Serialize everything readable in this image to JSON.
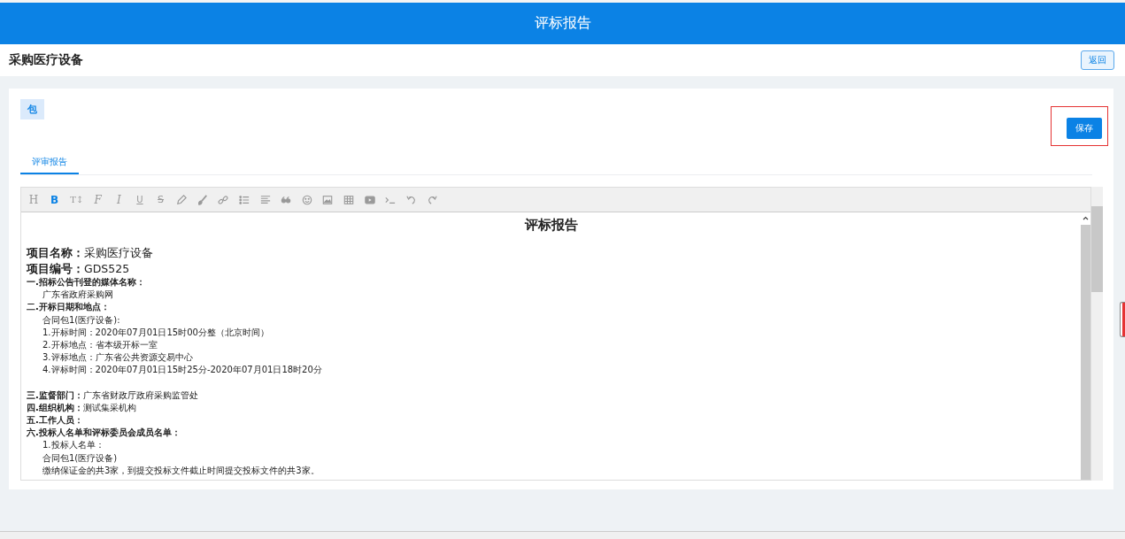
{
  "header": {
    "title": "评标报告"
  },
  "page": {
    "title": "采购医疗设备",
    "back_button": "返回"
  },
  "package_tag": "包",
  "save_button": {
    "label": "保存",
    "highlighted": true
  },
  "tabs": [
    {
      "label": "评审报告",
      "selected": true
    }
  ],
  "toolbar": [
    {
      "kind": "heading",
      "glyph": "H",
      "active": false
    },
    {
      "kind": "bold",
      "glyph": "B",
      "active": true
    },
    {
      "kind": "size",
      "glyph": "T↕",
      "active": false
    },
    {
      "kind": "font",
      "glyph": "F",
      "active": false
    },
    {
      "kind": "italic",
      "glyph": "I",
      "active": false
    },
    {
      "kind": "underline",
      "glyph": "U",
      "active": false
    },
    {
      "kind": "strike",
      "glyph": "S",
      "active": false
    },
    {
      "kind": "pencil",
      "active": false
    },
    {
      "kind": "brush",
      "active": false
    },
    {
      "kind": "link",
      "active": false
    },
    {
      "kind": "list",
      "active": false
    },
    {
      "kind": "align",
      "active": false
    },
    {
      "kind": "quote",
      "active": false
    },
    {
      "kind": "smile",
      "active": false
    },
    {
      "kind": "image",
      "active": false
    },
    {
      "kind": "table",
      "active": false
    },
    {
      "kind": "video",
      "active": false
    },
    {
      "kind": "terminal",
      "active": false
    },
    {
      "kind": "undo",
      "active": false
    },
    {
      "kind": "redo",
      "active": false
    }
  ],
  "document": {
    "title": "评标报告",
    "lines": [
      {
        "kind": "field",
        "label": "项目名称：",
        "value": "采购医疗设备"
      },
      {
        "kind": "field",
        "label": "项目编号：",
        "value": "GDS525"
      },
      {
        "kind": "heading",
        "label": "一.招标公告刊登的媒体名称："
      },
      {
        "kind": "item",
        "value": "广东省政府采购网"
      },
      {
        "kind": "heading",
        "label": "二.开标日期和地点："
      },
      {
        "kind": "item",
        "value": "合同包1(医疗设备):"
      },
      {
        "kind": "item",
        "value": "1.开标时间：2020年07月01日15时00分整（北京时间）"
      },
      {
        "kind": "item",
        "value": "2.开标地点：省本级开标一室"
      },
      {
        "kind": "item",
        "value": "3.评标地点：广东省公共资源交易中心"
      },
      {
        "kind": "item",
        "value": "4.评标时间：2020年07月01日15时25分-2020年07月01日18时20分"
      },
      {
        "kind": "spacer"
      },
      {
        "kind": "heading",
        "label": "三.监督部门：",
        "value": "广东省财政厅政府采购监管处"
      },
      {
        "kind": "heading",
        "label": "四.组织机构：",
        "value": "测试集采机构"
      },
      {
        "kind": "heading",
        "label": "五.工作人员："
      },
      {
        "kind": "heading",
        "label": "六.投标人名单和评标委员会成员名单："
      },
      {
        "kind": "item",
        "value": "1.投标人名单："
      },
      {
        "kind": "item",
        "value": "合同包1(医疗设备)"
      },
      {
        "kind": "item",
        "value": "缴纳保证金的共3家，到提交投标文件截止时间提交投标文件的共3家。"
      }
    ]
  }
}
